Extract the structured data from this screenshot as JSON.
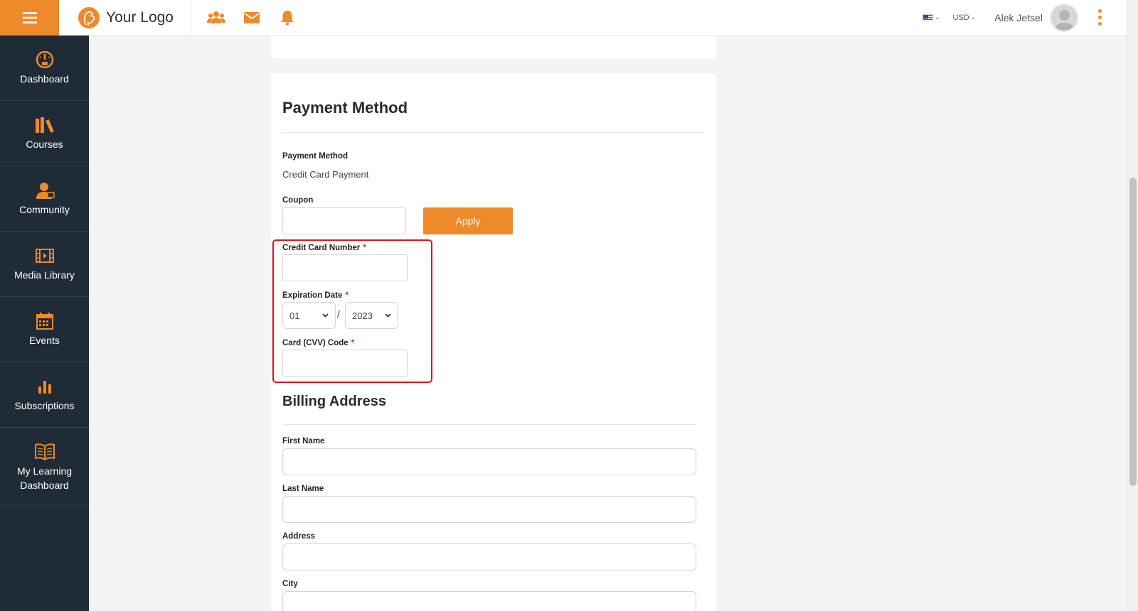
{
  "header": {
    "logo_text": "Your Logo",
    "currency": "USD",
    "user_name": "Alek Jetsel",
    "icons": [
      "users-icon",
      "envelope-icon",
      "bell-icon"
    ]
  },
  "sidebar": {
    "items": [
      {
        "label": "Dashboard",
        "icon": "dashboard-gauge-icon"
      },
      {
        "label": "Courses",
        "icon": "books-icon"
      },
      {
        "label": "Community",
        "icon": "community-user-icon"
      },
      {
        "label": "Media Library",
        "icon": "film-icon"
      },
      {
        "label": "Events",
        "icon": "calendar-icon"
      },
      {
        "label": "Subscriptions",
        "icon": "bar-chart-icon"
      },
      {
        "label": "My Learning Dashboard",
        "icon": "open-book-icon"
      }
    ]
  },
  "payment": {
    "title": "Payment Method",
    "method_label": "Payment Method",
    "method_value": "Credit Card Payment",
    "coupon_label": "Coupon",
    "coupon_value": "",
    "apply_label": "Apply",
    "card_number_label": "Credit Card Number",
    "expiration_label": "Expiration Date",
    "exp_month": "01",
    "exp_year": "2023",
    "separator": "/",
    "cvv_label": "Card (CVV) Code",
    "required_mark": "*"
  },
  "billing": {
    "title": "Billing Address",
    "first_name_label": "First Name",
    "last_name_label": "Last Name",
    "address_label": "Address",
    "city_label": "City"
  },
  "colors": {
    "accent": "#ee8a2a",
    "sidebar_bg": "#1f2b36",
    "highlight": "#e0141c"
  }
}
